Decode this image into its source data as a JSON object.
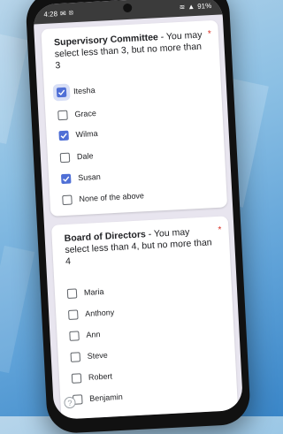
{
  "status_bar": {
    "time": "4:28",
    "battery": "91%"
  },
  "questions": [
    {
      "title": "Supervisory Committee",
      "description": " - You may select less than 3, but no more than 3",
      "required_mark": "*",
      "options": [
        {
          "label": "Itesha",
          "checked": true
        },
        {
          "label": "Grace",
          "checked": false
        },
        {
          "label": "Wilma",
          "checked": true
        },
        {
          "label": "Dale",
          "checked": false
        },
        {
          "label": "Susan",
          "checked": true
        },
        {
          "label": "None of the above",
          "checked": false
        }
      ]
    },
    {
      "title": "Board of Directors",
      "description": " - You may select less than 4, but no more than 4",
      "required_mark": "*",
      "options": [
        {
          "label": "Maria",
          "checked": false
        },
        {
          "label": "Anthony",
          "checked": false
        },
        {
          "label": "Ann",
          "checked": false
        },
        {
          "label": "Steve",
          "checked": false
        },
        {
          "label": "Robert",
          "checked": false
        },
        {
          "label": "Benjamin",
          "checked": false
        }
      ]
    }
  ],
  "help_icon_glyph": "?",
  "colors": {
    "accent": "#4f6fd6",
    "required": "#d93025"
  }
}
